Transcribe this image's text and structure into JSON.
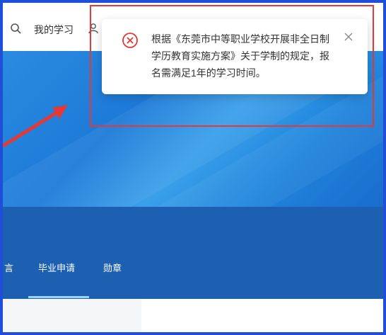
{
  "header": {
    "study_link": "我的学习"
  },
  "tabs": [
    {
      "label": "言"
    },
    {
      "label": "毕业申请"
    },
    {
      "label": "勋章"
    }
  ],
  "toast": {
    "message": "根据《东莞市中等职业学校开展非全日制学历教育实施方案》关于学制的规定，报名需满足1年的学习时间。",
    "icon": "error-circle-icon",
    "close_icon": "close-icon"
  },
  "colors": {
    "accent": "#1d5fb1",
    "error": "#e53935",
    "frame": "#1f4fd8"
  }
}
